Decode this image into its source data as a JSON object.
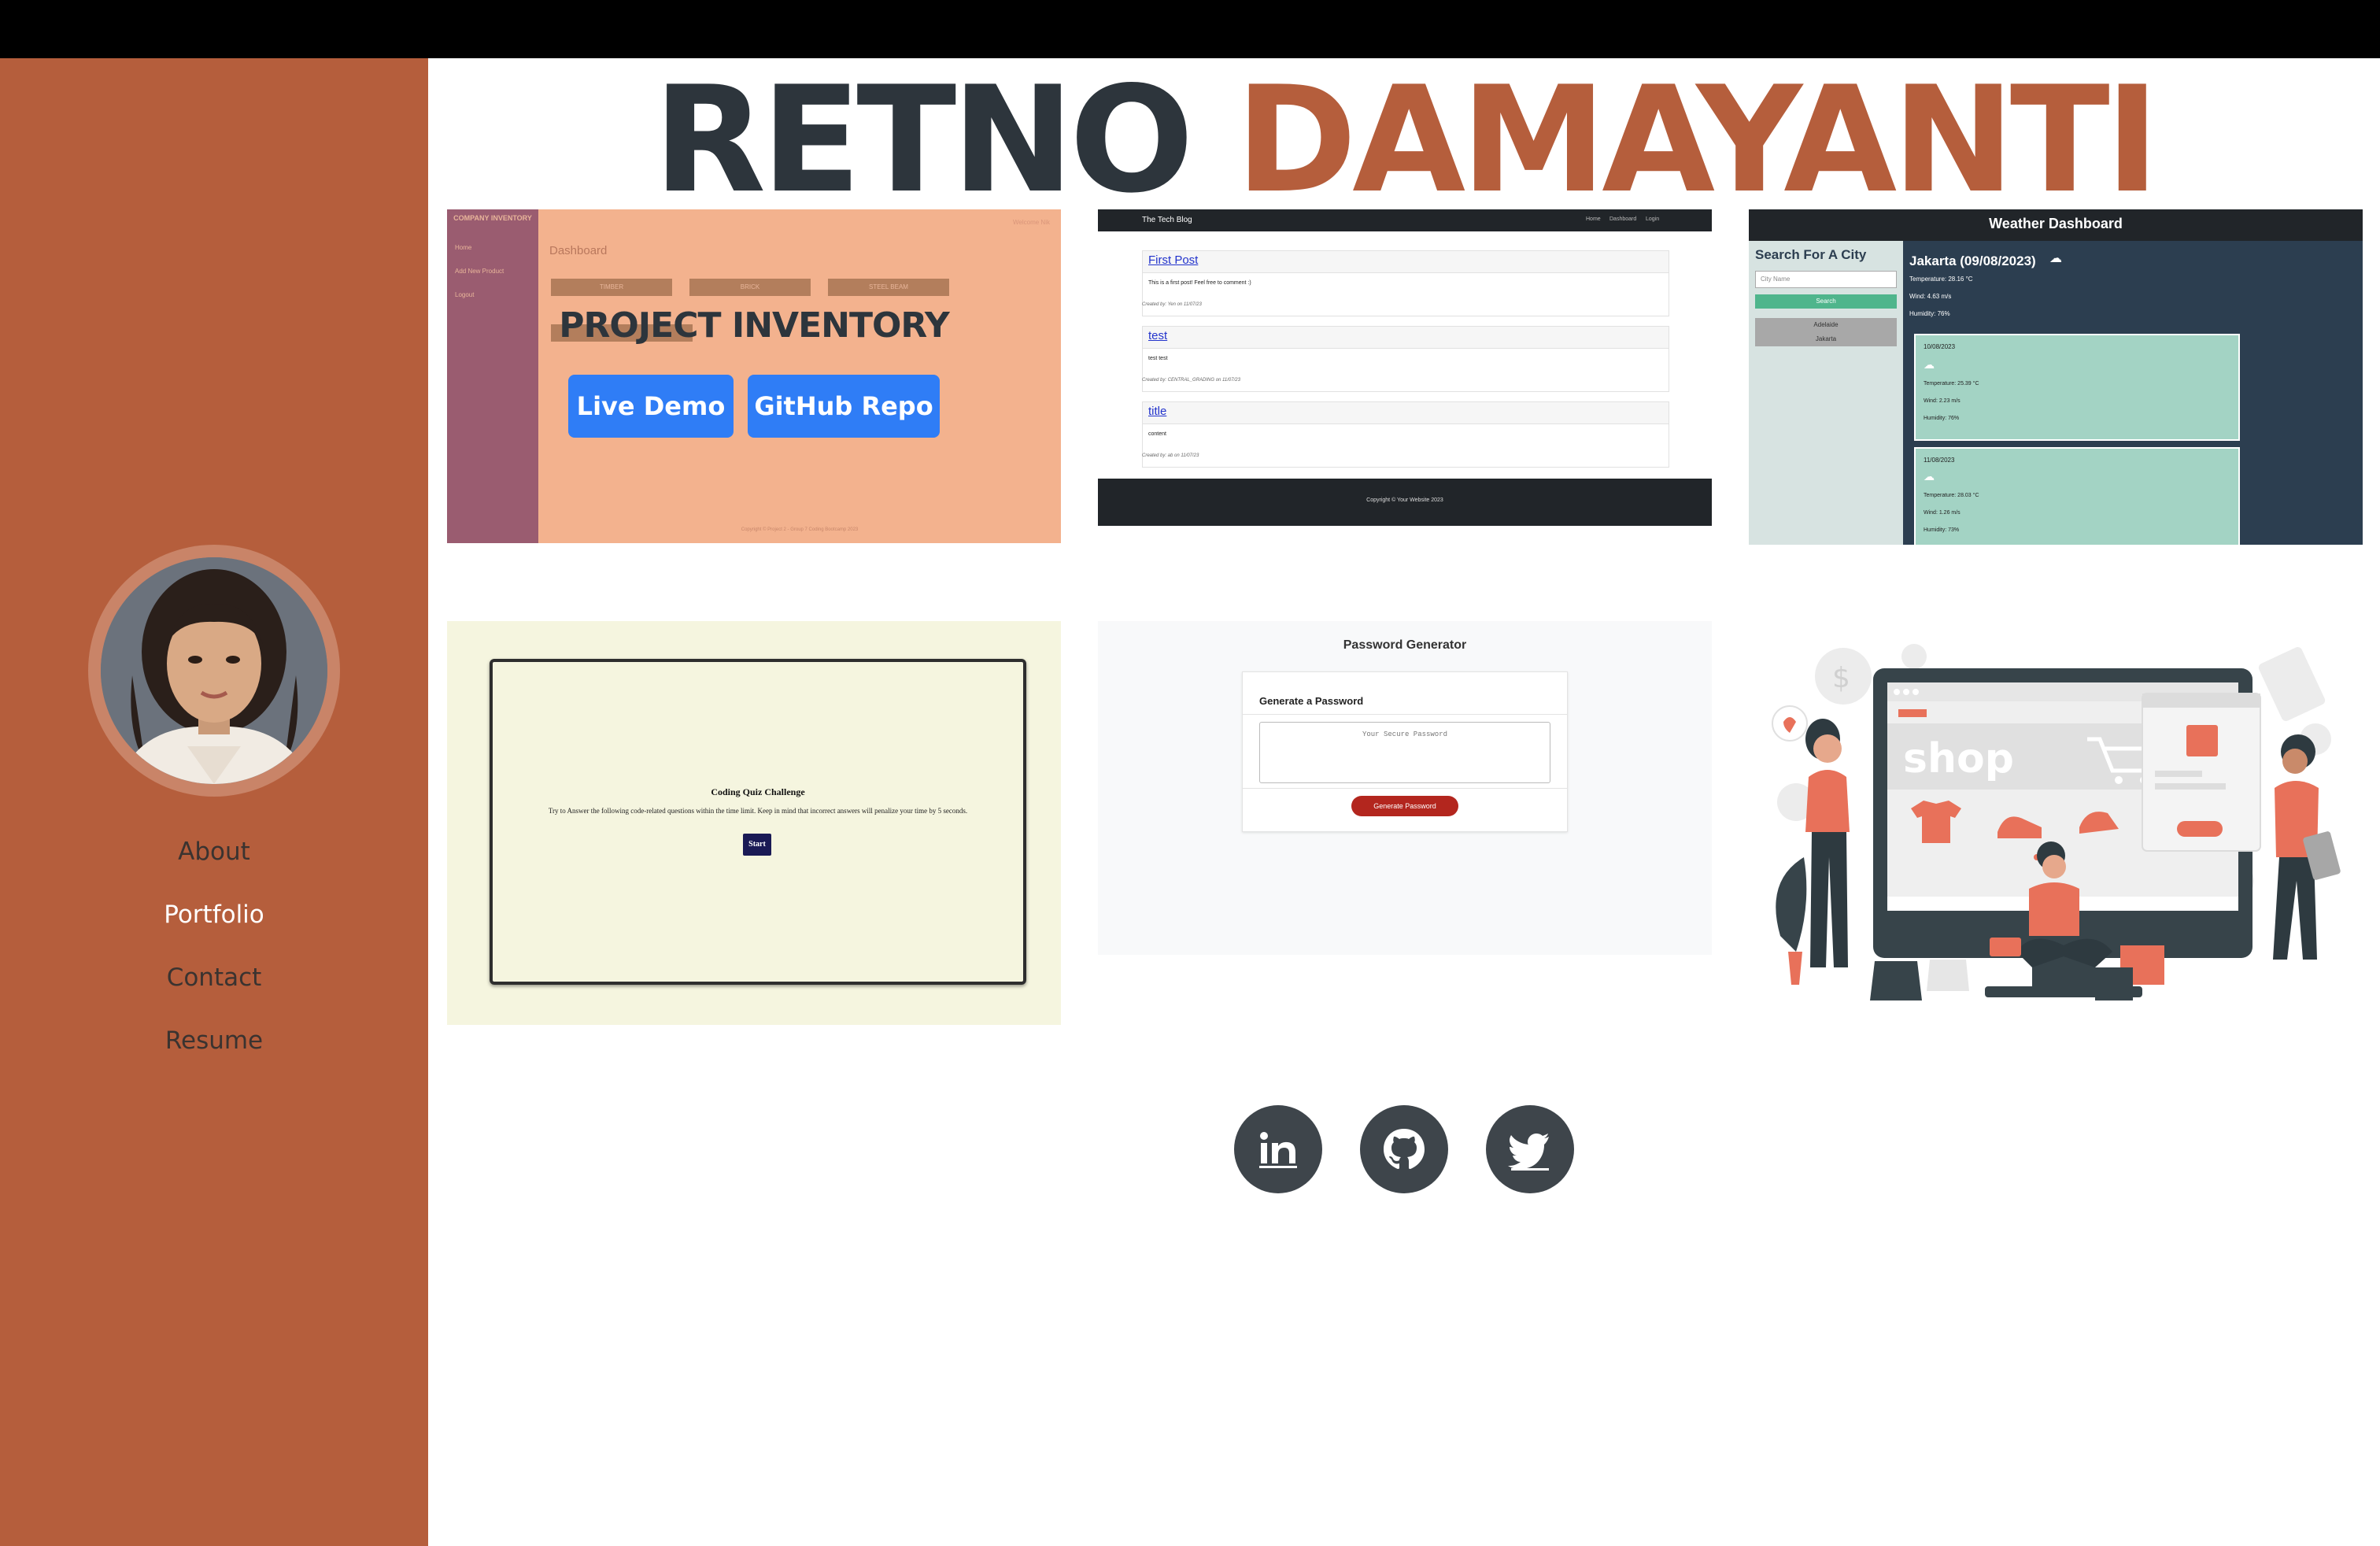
{
  "header": {
    "first_name": "RETNO",
    "last_name": "DAMAYANTI"
  },
  "sidebar": {
    "nav": [
      {
        "label": "About",
        "active": false
      },
      {
        "label": "Portfolio",
        "active": true
      },
      {
        "label": "Contact",
        "active": false
      },
      {
        "label": "Resume",
        "active": false
      }
    ]
  },
  "projects": {
    "inventory": {
      "brand": "COMPANY INVENTORY",
      "menu": [
        "Home",
        "Add New Product",
        "Logout"
      ],
      "welcome": "Welcome Nik",
      "heading": "Dashboard",
      "categories": [
        "TIMBER",
        "BRICK",
        "STEEL BEAM"
      ],
      "title": "PROJECT INVENTORY",
      "live_demo": "Live Demo",
      "github_repo": "GitHub Repo",
      "footer": "Copyright © Project 2 - Group 7 Coding Bootcamp 2023"
    },
    "techblog": {
      "brand": "The Tech Blog",
      "nav": [
        "Home",
        "Dashboard",
        "Login"
      ],
      "posts": [
        {
          "title": "First Post",
          "body": "This is a first post! Feel free to comment :)",
          "meta": "Created by: Yen on 11/07/23"
        },
        {
          "title": "test",
          "body": "test test",
          "meta": "Created by: CENTRAL_GRADING on 11/07/23"
        },
        {
          "title": "title",
          "body": "content",
          "meta": "Created by: ab on 11/07/23"
        }
      ],
      "footer": "Copyright © Your Website 2023"
    },
    "weather": {
      "title": "Weather Dashboard",
      "search_heading": "Search For A City",
      "search_placeholder": "City Name",
      "search_button": "Search",
      "history": [
        "Adelaide",
        "Jakarta"
      ],
      "current_city": "Jakarta (09/08/2023)",
      "current": [
        "Temperature: 28.16 °C",
        "Wind: 4.63 m/s",
        "Humidity: 76%"
      ],
      "forecast": [
        {
          "date": "10/08/2023",
          "lines": [
            "Temperature: 25.39 °C",
            "Wind: 2.23 m/s",
            "Humidity: 76%"
          ]
        },
        {
          "date": "11/08/2023",
          "lines": [
            "Temperature: 28.03 °C",
            "Wind: 1.26 m/s",
            "Humidity: 73%"
          ]
        }
      ]
    },
    "quiz": {
      "title": "Coding Quiz Challenge",
      "body": "Try to Answer the following code-related questions within the time limit. Keep in mind that incorrect answers will penalize your time by 5 seconds.",
      "start": "Start"
    },
    "password": {
      "title": "Password Generator",
      "card_heading": "Generate a Password",
      "placeholder": "Your Secure Password",
      "button": "Generate Password"
    },
    "shop": {
      "sign": "shop"
    }
  },
  "colors": {
    "accent": "#b55e3c",
    "dark": "#2d353c"
  }
}
